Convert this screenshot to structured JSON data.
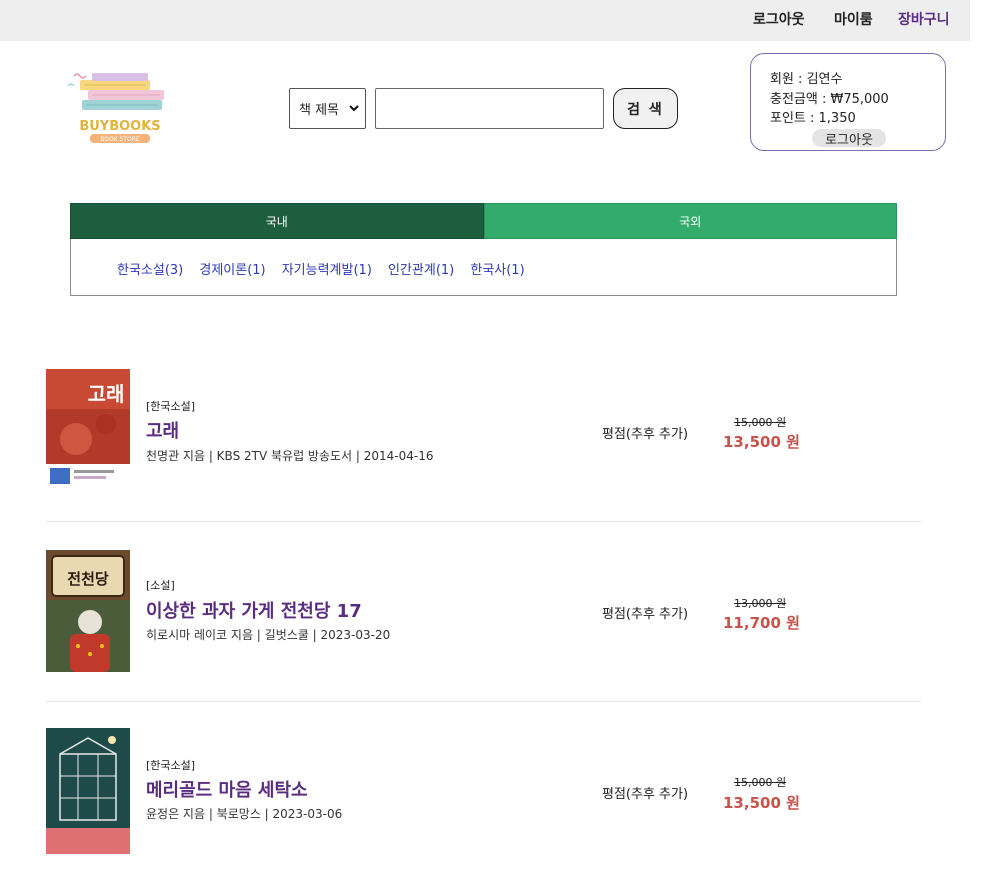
{
  "topnav": {
    "logout": "로그아웃",
    "mypage": "마이룸",
    "cart": "장바구니"
  },
  "logo": {
    "brand": "BUYBOOKS",
    "tagline": "BOOK STORE"
  },
  "search": {
    "field_selected": "책 제목",
    "placeholder": "",
    "button": "검 색"
  },
  "member": {
    "name_line": "회원 : 김연수",
    "charge_line": "충전금액 : ₩75,000",
    "point_line": "포인트 : 1,350",
    "logout": "로그아웃"
  },
  "tabs": [
    {
      "label": "국내"
    },
    {
      "label": "국외"
    }
  ],
  "subcategories": [
    {
      "label": "한국소설(3)"
    },
    {
      "label": "경제이론(1)"
    },
    {
      "label": "자기능력계발(1)"
    },
    {
      "label": "인간관계(1)"
    },
    {
      "label": "한국사(1)"
    }
  ],
  "books": [
    {
      "category": "[한국소설]",
      "title": "고래",
      "meta": "천명관 지음 | KBS 2TV 북유럽 방송도서 | 2014-04-16",
      "rating": "평점(추후 추가)",
      "original_price": "15,000 원",
      "price": "13,500 원",
      "cover_title": "고래"
    },
    {
      "category": "[소설]",
      "title": "이상한 과자 가게 전천당 17",
      "meta": "히로시마 레이코 지음 | 길벗스쿨 | 2023-03-20",
      "rating": "평점(추후 추가)",
      "original_price": "13,000 원",
      "price": "11,700 원",
      "cover_title": "전천당"
    },
    {
      "category": "[한국소설]",
      "title": "메리골드 마음 세탁소",
      "meta": "윤정은 지음 | 북로망스 | 2023-03-06",
      "rating": "평점(추후 추가)",
      "original_price": "15,000 원",
      "price": "13,500 원",
      "cover_title": ""
    }
  ],
  "colors": {
    "tab_domestic": "#1c5e3d",
    "tab_foreign": "#33ab6b",
    "title": "#5b2d82",
    "price": "#c8534b",
    "subcategory_link": "#2d3bb3"
  }
}
